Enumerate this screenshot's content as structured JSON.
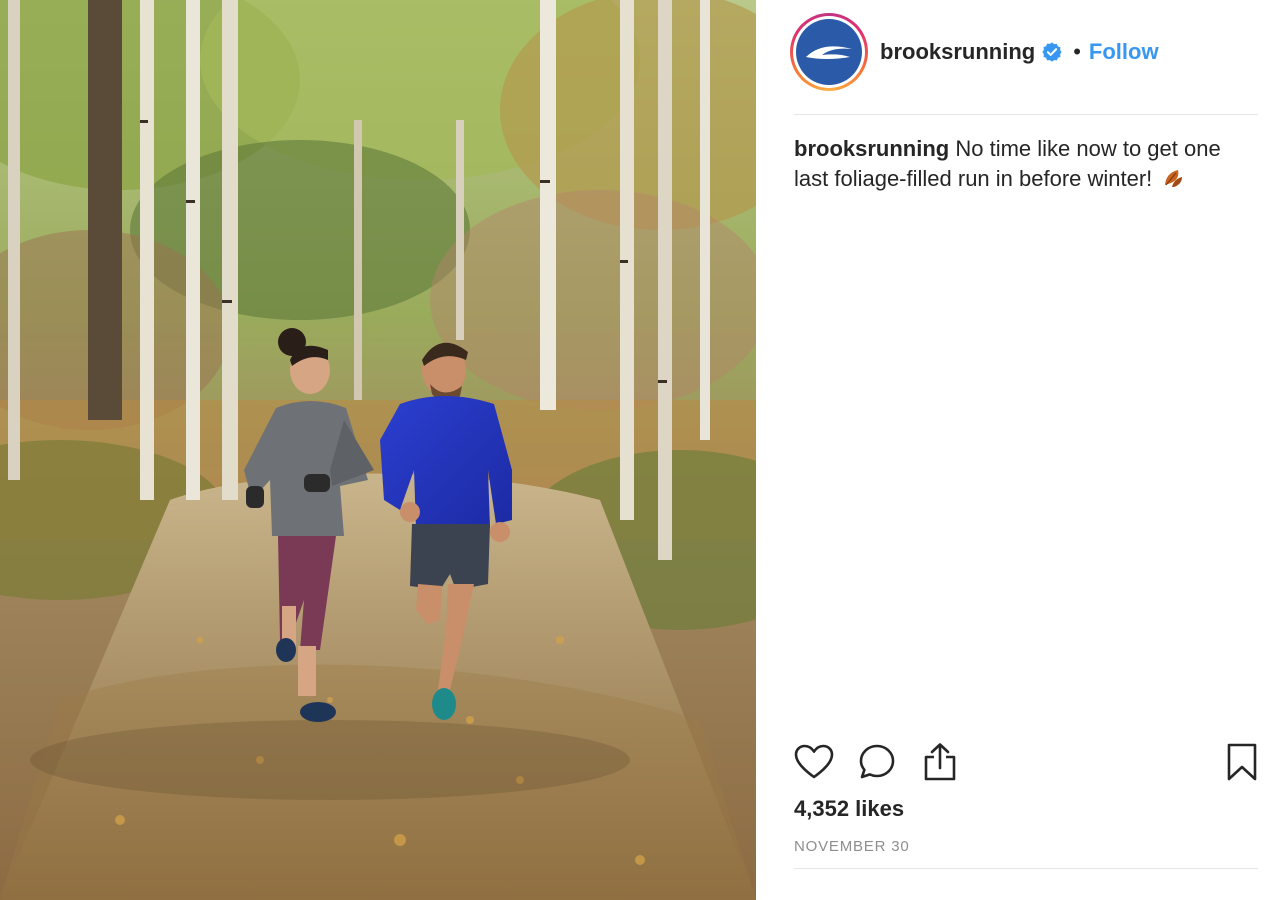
{
  "post": {
    "username": "brooksrunning",
    "verified": true,
    "separator": "•",
    "follow_label": "Follow",
    "caption_user": "brooksrunning",
    "caption_text": "No time like now to get one last foliage-filled run in before winter!",
    "likes": "4,352 likes",
    "date": "NOVEMBER 30"
  },
  "photo": {
    "subject": "two runners on an autumn forest trail"
  },
  "icons": {
    "like": "heart-icon",
    "comment": "comment-bubble-icon",
    "share": "share-icon",
    "save": "bookmark-icon",
    "verified": "verified-badge-icon"
  },
  "colors": {
    "follow": "#3897f0",
    "verified": "#3897f0",
    "avatar_bg": "#2a5aa8",
    "date": "#8e8e8e"
  }
}
